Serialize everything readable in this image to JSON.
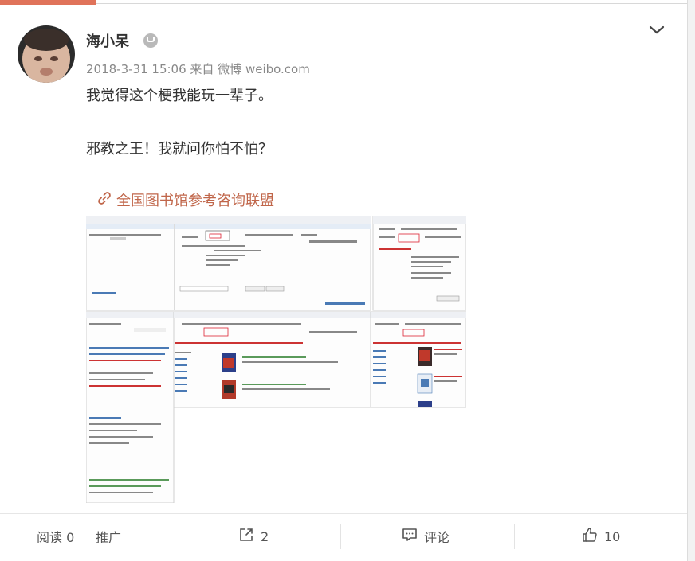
{
  "post": {
    "author": "海小呆",
    "time": "2018-3-31 15:06",
    "source": "来自 微博 weibo.com",
    "line1": "我觉得这个梗我能玩一辈子。",
    "line2": "邪教之王！我就问你怕不怕？",
    "link_text": "全国图书馆参考咨询联盟"
  },
  "footer": {
    "read_label": "阅读 0",
    "promote_label": "推广",
    "share_count": "2",
    "comment_label": "评论",
    "like_count": "10"
  },
  "colors": {
    "accent": "#e0735a",
    "link": "#c0664a",
    "text": "#333333",
    "muted": "#888888"
  }
}
